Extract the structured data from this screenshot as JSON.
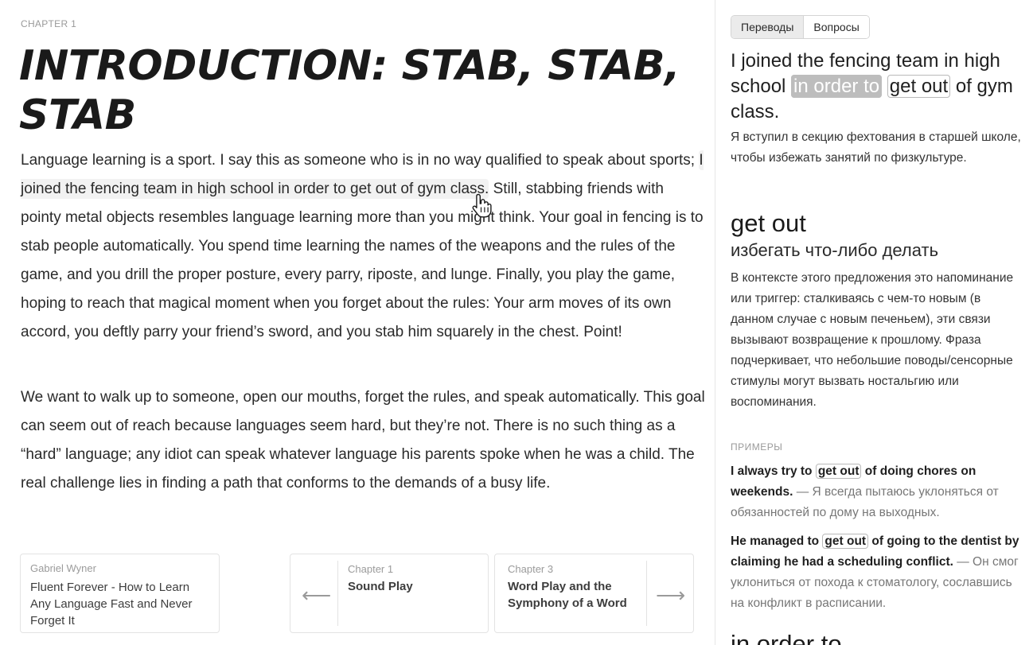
{
  "main": {
    "chapter_label": "CHAPTER 1",
    "title": "INTRODUCTION: STAB, STAB, STAB",
    "paragraphs": [
      {
        "before": "Language learning is a sport. I say this as someone who is in no way qualified to speak about sports; ",
        "highlight": "I joined the fencing team in high school in order to get out of gym class.",
        "after": " Still, stabbing friends with pointy metal objects resembles language learning more than you might think. Your goal in fencing is to stab people automatically. You spend time learning the names of the weapons and the rules of the game, and you drill the proper posture, every parry, riposte, and lunge. Finally, you play the game, hoping to reach that magical moment when you forget about the rules: Your arm moves of its own accord, you deftly parry your friend’s sword, and you stab him squarely in the chest. Point!"
      },
      {
        "text": "We want to walk up to someone, open our mouths, forget the rules, and speak automatically. This goal can seem out of reach because languages seem hard, but they’re not. There is no such thing as a “hard” language; any idiot can speak whatever language his parents spoke when he was a child. The real challenge lies in finding a path that conforms to the demands of a busy life."
      }
    ],
    "cards": {
      "book": {
        "author": "Gabriel Wyner",
        "title": "Fluent Forever - How to Learn Any Language Fast and Never Forget It"
      },
      "prev": {
        "label": "Chapter 1",
        "title": "Sound Play"
      },
      "next": {
        "label": "Chapter 3",
        "title": "Word Play and the Symphony of a Word"
      }
    }
  },
  "sidebar": {
    "tabs": [
      "Переводы",
      "Вопросы"
    ],
    "active_tab": 0,
    "sentence": {
      "before": "I joined the fencing team in high school ",
      "selected_chip": "in order to",
      "chip": "get out",
      "after": " of gym class."
    },
    "translation": "Я вступил в секцию фехтования в старшей школе, чтобы избежать занятий по физкультуре.",
    "term": "get out",
    "term_translation": "избегать что-либо делать",
    "explanation": "В контексте этого предложения это напоминание или триггер: сталкиваясь с чем-то новым (в данном случае с новым печеньем), эти связи вызывают возвращение к прошлому. Фраза подчеркивает, что небольшие поводы/сенсорные стимулы могут вызвать ностальгию или воспоминания.",
    "examples_label": "ПРИМЕРЫ",
    "examples": [
      {
        "before": "I always try to ",
        "chip": "get out",
        "after": " of doing chores on weekends.",
        "translation": " — Я всегда пытаюсь уклоняться от обязанностей по дому на выходных."
      },
      {
        "before": "He managed to ",
        "chip": "get out",
        "after": " of going to the dentist by claiming he had a scheduling conflict.",
        "translation": " — Он смог уклониться от похода к стоматологу, сославшись на конфликт в расписании."
      }
    ],
    "next_term": "in order to"
  }
}
